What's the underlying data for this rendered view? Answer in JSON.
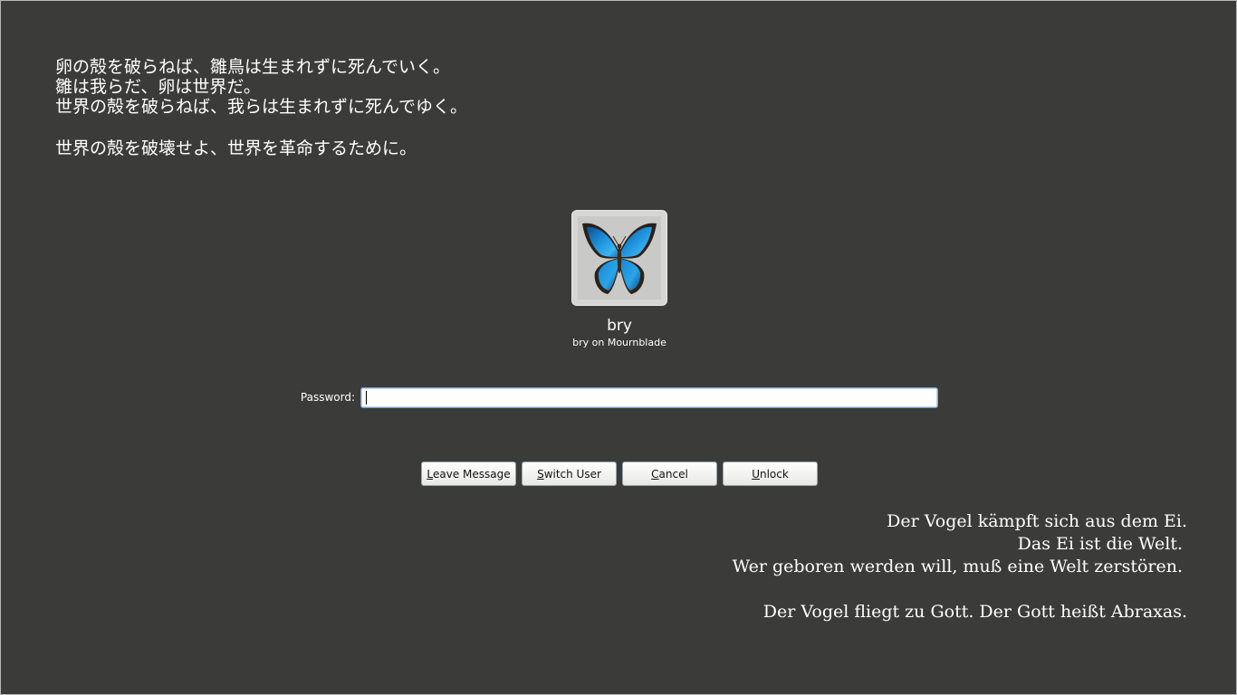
{
  "quotes": {
    "japanese": [
      "卵の殻を破らねば、雛鳥は生まれずに死んでいく。",
      "雛は我らだ、卵は世界だ。",
      "世界の殻を破らねば、我らは生まれずに死んでゆく。",
      "",
      "世界の殻を破壊せよ、世界を革命するために。"
    ],
    "german": [
      "Der Vogel kämpft sich aus dem Ei.",
      "Das Ei ist die Welt.",
      "Wer geboren werden will, muß eine Welt zerstören.",
      "",
      "Der Vogel fliegt zu Gott. Der Gott heißt Abraxas."
    ]
  },
  "user": {
    "avatar_icon": "butterfly-icon",
    "name": "bry",
    "host_line": "bry on Mournblade"
  },
  "password": {
    "label": "Password:",
    "value": ""
  },
  "buttons": {
    "leave_message": {
      "mnemonic": "L",
      "rest": "eave Message"
    },
    "switch_user": {
      "mnemonic": "S",
      "rest": "witch User"
    },
    "cancel": {
      "mnemonic": "C",
      "rest": "ancel"
    },
    "unlock": {
      "mnemonic": "U",
      "rest": "nlock"
    }
  },
  "colors": {
    "background": "#3b3c3a",
    "text": "#ffffff",
    "butterfly_blue": "#1e8fd8"
  }
}
